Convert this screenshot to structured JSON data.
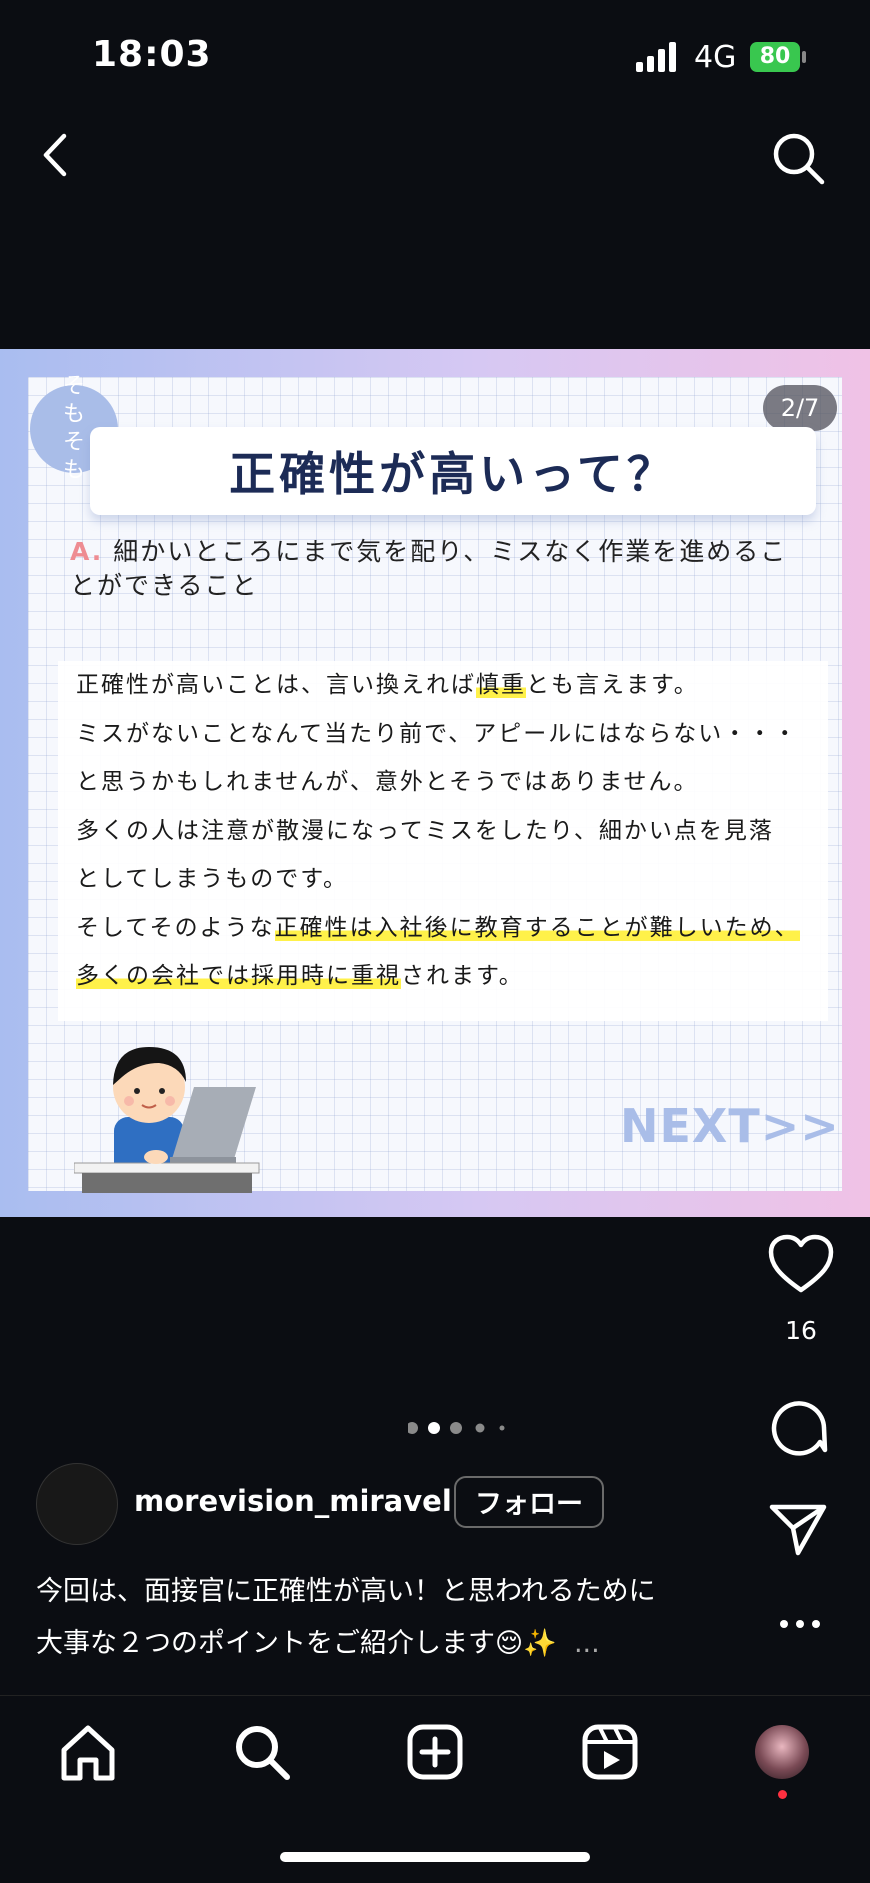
{
  "status_bar": {
    "time": "18:03",
    "network": "4G",
    "battery": "80"
  },
  "post": {
    "badge": "そもそも",
    "counter": "2/7",
    "title": "正確性が高いって？",
    "answer_mark": "A.",
    "answer_text": "細かいところにまで気を配り、ミスなく作業を進めることができること",
    "body": {
      "l1a": "正確性が高いことは、言い換えれば",
      "l1b": "慎重",
      "l1c": "とも言えます。",
      "l2": "ミスがないことなんて当たり前で、アピールにはならない・・・",
      "l3": "と思うかもしれませんが、意外とそうではありません。",
      "l4": "多くの人は注意が散漫になってミスをしたり、細かい点を見落",
      "l5": "としてしまうものです。",
      "l6a": "そしてそのような",
      "l6b": "正確性は入社後に教育することが難しいため、",
      "l7a": "多くの会社では採用時に重視",
      "l7b": "されます。"
    },
    "next": "NEXT>>"
  },
  "actions": {
    "like_count": "16"
  },
  "account": {
    "username": "morevision_miravel",
    "follow_label": "フォロー"
  },
  "caption": {
    "line1": "今回は、面接官に正確性が高い！と思われるために",
    "line2": "大事な２つのポイントをご紹介します😌✨",
    "more": "..."
  },
  "colors": {
    "accent_badge": "#a9bde8",
    "highlight": "#fff14a",
    "title": "#1c2b56",
    "battery": "#39c74f"
  }
}
